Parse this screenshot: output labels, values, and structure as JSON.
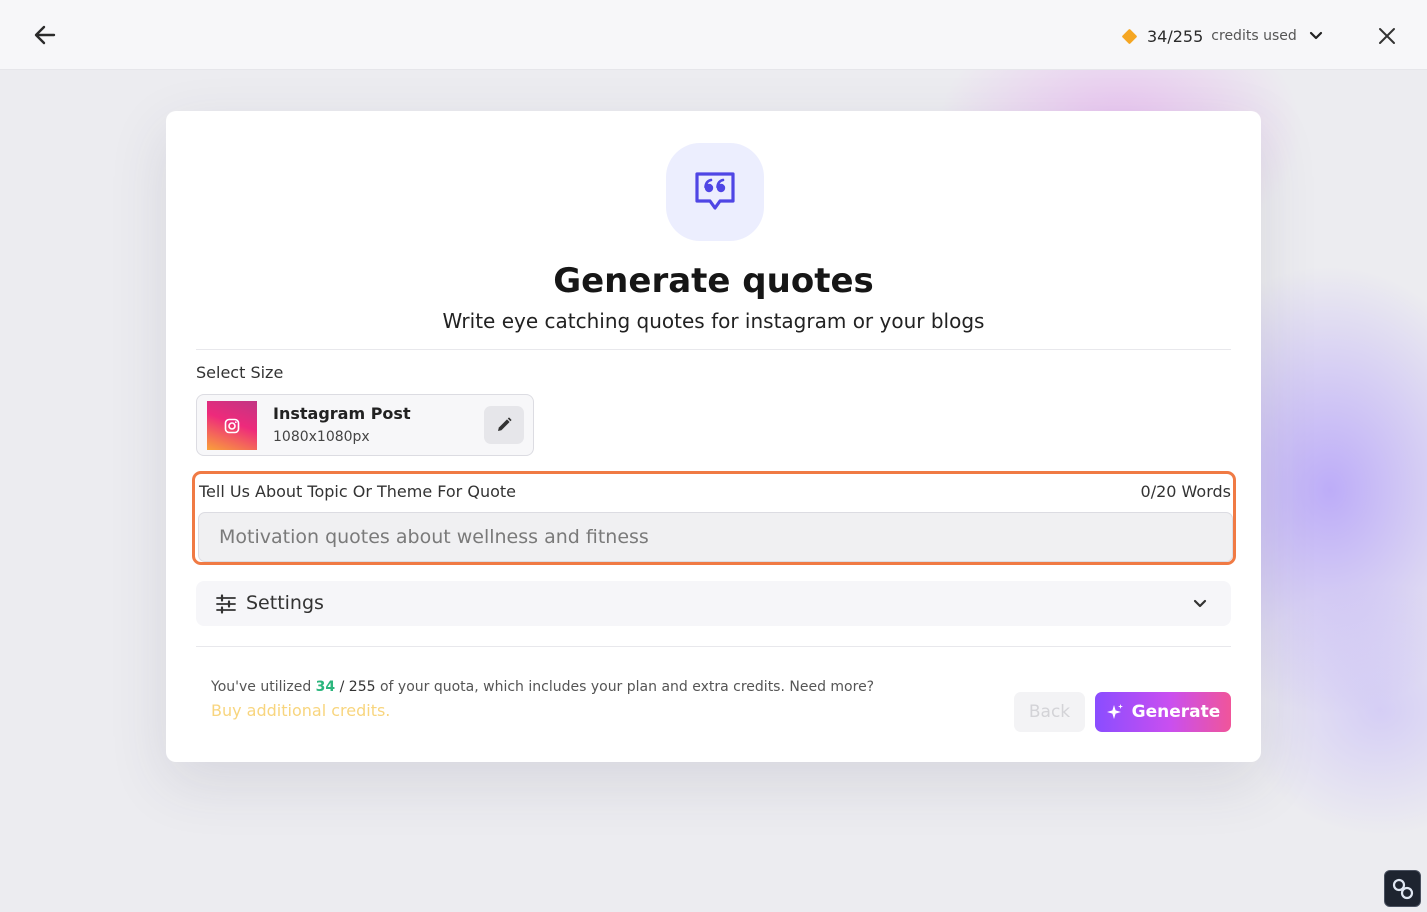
{
  "header": {
    "credits_count": "34/255",
    "credits_label": "credits used"
  },
  "hero": {
    "title": "Generate quotes",
    "subtitle": "Write eye catching quotes for instagram or your blogs"
  },
  "size_select": {
    "label": "Select Size",
    "name": "Instagram Post",
    "dimensions": "1080x1080px"
  },
  "topic": {
    "label": "Tell Us About Topic Or Theme For Quote",
    "word_count": "0/20 Words",
    "placeholder": "Motivation quotes about wellness and fitness",
    "value": ""
  },
  "settings": {
    "label": "Settings"
  },
  "footer": {
    "quota_prefix": "You've utilized",
    "quota_used": "34",
    "quota_sep": "/",
    "quota_total": "255",
    "quota_suffix": "of your quota, which includes your plan and extra credits. Need more?",
    "buy_link": "Buy additional credits.",
    "back_label": "Back",
    "generate_label": "Generate"
  },
  "colors": {
    "accent_orange": "#f07a44",
    "credit_diamond": "#f5a623",
    "quota_used_green": "#2cb67d",
    "buy_link_yellow": "#f8d57e",
    "hero_icon": "#4f46e5"
  }
}
